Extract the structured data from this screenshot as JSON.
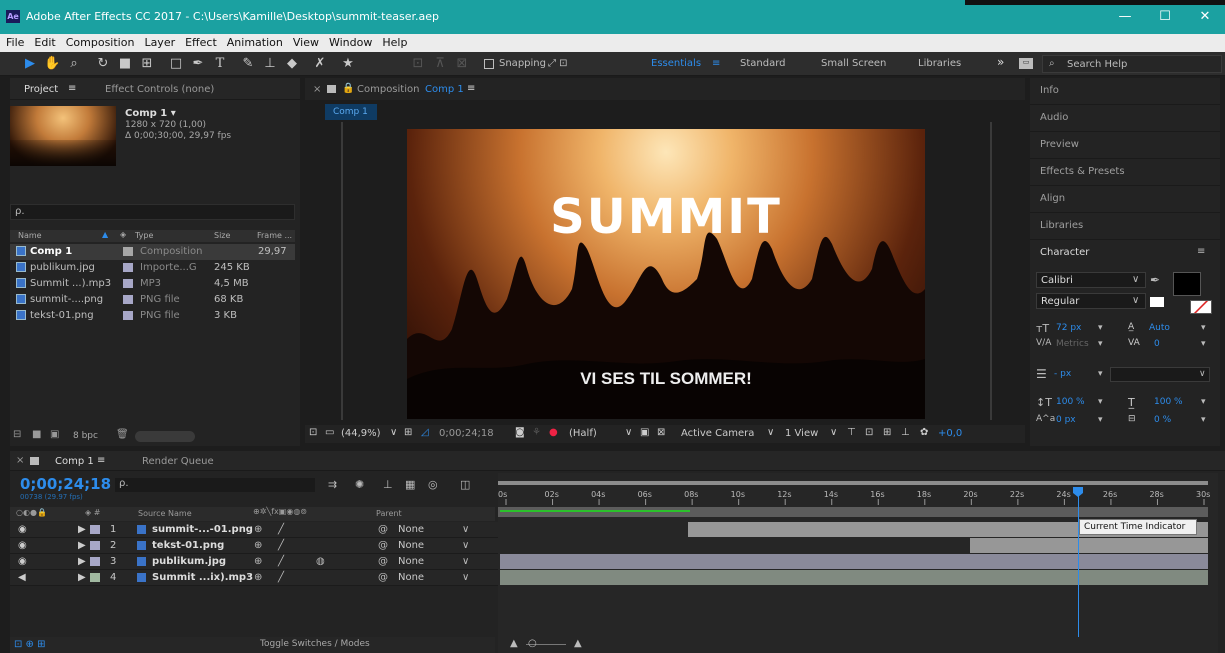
{
  "window": {
    "title": "Adobe After Effects CC 2017 - C:\\Users\\Kamille\\Desktop\\summit-teaser.aep",
    "app_icon": "Ae",
    "minimize": "—",
    "maximize": "☐",
    "close": "✕"
  },
  "menu": [
    "File",
    "Edit",
    "Composition",
    "Layer",
    "Effect",
    "Animation",
    "View",
    "Window",
    "Help"
  ],
  "toolbar": {
    "snapping": "Snapping",
    "workspaces": [
      "Essentials",
      "Standard",
      "Small Screen",
      "Libraries"
    ],
    "more": "»",
    "search_placeholder": "Search Help"
  },
  "project": {
    "tab_project": "Project",
    "tab_effect": "Effect Controls (none)",
    "comp_name": "Comp 1 ▾",
    "comp_size": "1280 x 720 (1,00)",
    "comp_dur": "Δ 0;00;30;00, 29,97 fps",
    "search_icon": "ρ.",
    "headers": [
      "Name",
      "Type",
      "Size",
      "Frame ..."
    ],
    "items": [
      {
        "name": "Comp 1",
        "type": "Composition",
        "size": "",
        "fr": "29,97",
        "color": "#a7a7a7",
        "icon": "comp-icon"
      },
      {
        "name": "publikum.jpg",
        "type": "Importe...G",
        "size": "245 KB",
        "fr": "",
        "color": "#a7a7c7",
        "icon": "image-icon"
      },
      {
        "name": "Summit ...).mp3",
        "type": "MP3",
        "size": "4,5 MB",
        "fr": "",
        "color": "#a7a7c7",
        "icon": "audio-icon"
      },
      {
        "name": "summit-....png",
        "type": "PNG file",
        "size": "68 KB",
        "fr": "",
        "color": "#a7a7c7",
        "icon": "image-icon"
      },
      {
        "name": "tekst-01.png",
        "type": "PNG file",
        "size": "3 KB",
        "fr": "",
        "color": "#a7a7c7",
        "icon": "image-icon"
      }
    ],
    "bpc": "8 bpc"
  },
  "comp": {
    "tab": "Composition",
    "tab_name": "Comp 1",
    "subtab": "Comp 1",
    "summit_text": "SUMMIT",
    "tagline": "VI SES TIL SOMMER!",
    "zoom": "(44,9%)",
    "timecode": "0;00;24;18",
    "quality": "(Half)",
    "camera": "Active Camera",
    "views": "1 View",
    "exposure": "+0,0"
  },
  "right": {
    "items": [
      "Info",
      "Audio",
      "Preview",
      "Effects & Presets",
      "Align",
      "Libraries",
      "Character"
    ],
    "font": "Calibri",
    "style": "Regular",
    "size": "72 px",
    "leading": "Auto",
    "kerning": "Metrics",
    "tracking": "0",
    "stroke": "- px",
    "vscale": "100 %",
    "hscale": "100 %",
    "baseline": "0 px",
    "tsume": "0 %"
  },
  "timeline": {
    "tab": "Comp 1",
    "render_tab": "Render Queue",
    "time": "0;00;24;18",
    "frames": "00738 (29.97 fps)",
    "col_source": "Source Name",
    "col_parent": "Parent",
    "ticks": [
      "0s",
      "02s",
      "04s",
      "06s",
      "08s",
      "10s",
      "12s",
      "14s",
      "16s",
      "18s",
      "20s",
      "22s",
      "24s",
      "26s",
      "28s",
      "30s"
    ],
    "tooltip": "Current Time Indicator",
    "toggle": "Toggle Switches / Modes",
    "layers": [
      {
        "num": "1",
        "name": "summit-...-01.png",
        "parent": "None",
        "color": "#a7a7c7"
      },
      {
        "num": "2",
        "name": "tekst-01.png",
        "parent": "None",
        "color": "#a7a7c7"
      },
      {
        "num": "3",
        "name": "publikum.jpg",
        "parent": "None",
        "color": "#a7a7c7"
      },
      {
        "num": "4",
        "name": "Summit ...ix).mp3",
        "parent": "None",
        "color": "#a0b8a0"
      }
    ]
  }
}
